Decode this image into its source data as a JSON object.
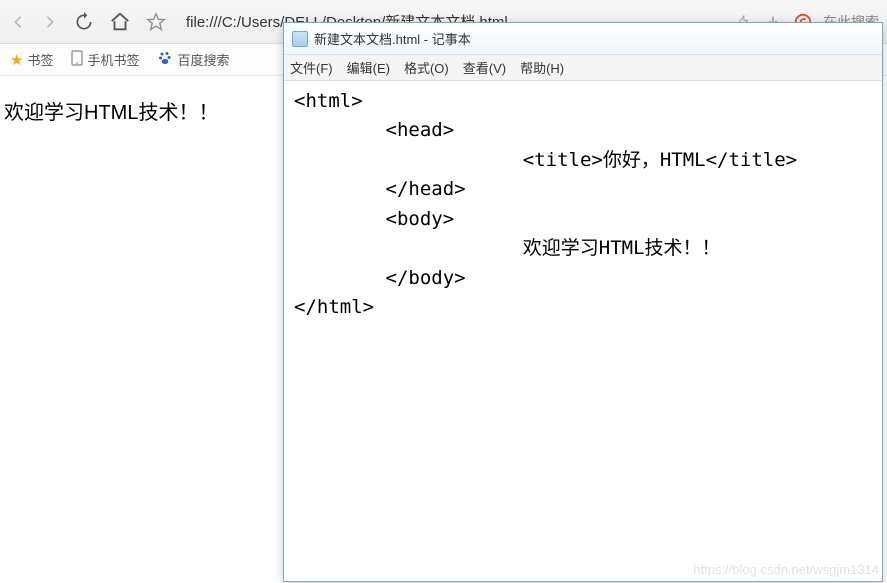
{
  "browser": {
    "address": "file:///C:/Users/DELL/Desktop/新建文本文档.html",
    "search_placeholder": "在此搜索",
    "bookmarks": {
      "b1": "书签",
      "b2": "手机书签",
      "b3": "百度搜索"
    },
    "page_text": "欢迎学习HTML技术！！"
  },
  "notepad": {
    "title": "新建文本文档.html - 记事本",
    "menus": {
      "file": "文件(F)",
      "edit": "编辑(E)",
      "format": "格式(O)",
      "view": "查看(V)",
      "help": "帮助(H)"
    },
    "lines": {
      "l1": "<html>",
      "l2": "        <head>",
      "l3": "                    <title>你好，HTML</title>",
      "l4": "        </head>",
      "l5": "        <body>",
      "l6": "                    欢迎学习HTML技术！！",
      "l7": "        </body>",
      "l8": "</html>"
    }
  },
  "watermark": "https://blog.csdn.net/wsgjm1314"
}
